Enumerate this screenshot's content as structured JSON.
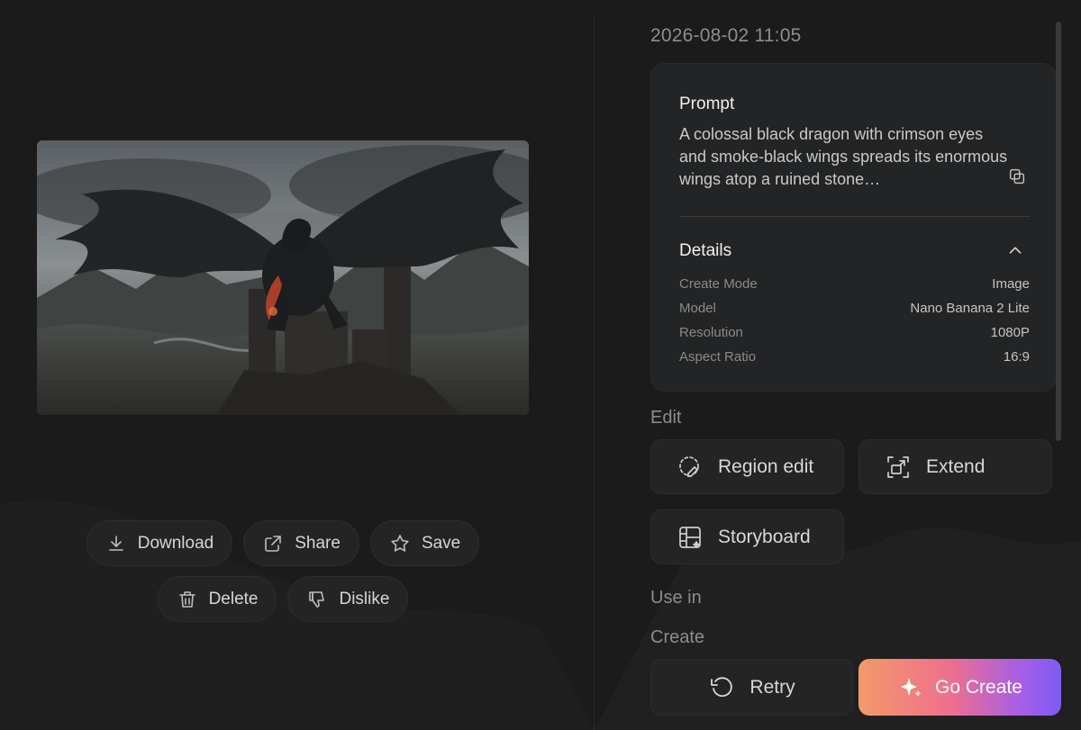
{
  "timestamp": "2026-08-02 11:05",
  "prompt": {
    "title": "Prompt",
    "text": "A colossal black dragon with crimson eyes and smoke-black wings spreads its enormous wings atop a ruined stone…"
  },
  "details": {
    "title": "Details",
    "rows": [
      {
        "label": "Create Mode",
        "value": "Image"
      },
      {
        "label": "Model",
        "value": "Nano Banana 2 Lite"
      },
      {
        "label": "Resolution",
        "value": "1080P"
      },
      {
        "label": "Aspect Ratio",
        "value": "16:9"
      }
    ]
  },
  "edit": {
    "label": "Edit",
    "region_edit": "Region edit",
    "extend": "Extend",
    "storyboard": "Storyboard"
  },
  "use_in": {
    "label": "Use in",
    "create_label": "Create",
    "retry": "Retry",
    "go_create": "Go Create"
  },
  "actions": {
    "download": "Download",
    "share": "Share",
    "save": "Save",
    "delete": "Delete",
    "dislike": "Dislike"
  },
  "colors": {
    "background": "#1b1b1b",
    "card": "#232425",
    "button": "#242424",
    "gradient_start": "#f39a6a",
    "gradient_mid": "#ef6f8d",
    "gradient_end": "#7d5cf0"
  },
  "icons": [
    "download-icon",
    "share-icon",
    "star-icon",
    "trash-icon",
    "thumbs-down-icon",
    "copy-icon",
    "chevron-up-icon",
    "region-edit-icon",
    "extend-icon",
    "storyboard-icon",
    "retry-icon",
    "sparkle-icon"
  ]
}
